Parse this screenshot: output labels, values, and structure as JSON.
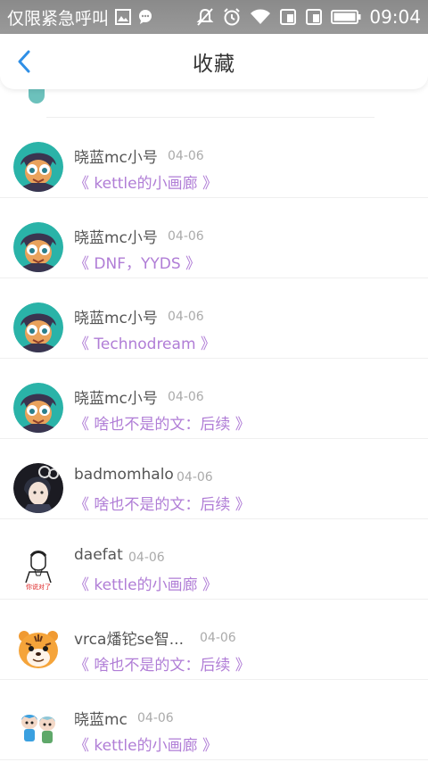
{
  "status_bar": {
    "left_text": "仅限紧急呼叫",
    "time": "09:04",
    "icons": [
      "image-icon",
      "chat-icon",
      "mute-icon",
      "alarm-icon",
      "wifi-icon",
      "sim1-icon",
      "sim2-icon",
      "battery-icon"
    ]
  },
  "header": {
    "back_icon": "chevron-left-icon",
    "title": "收藏"
  },
  "items": [
    {
      "name": "晓蓝mc小号",
      "date": "04-06",
      "link": "《 kettle的小画廊 》",
      "avatar": "hero"
    },
    {
      "name": "晓蓝mc小号",
      "date": "04-06",
      "link": "《 DNF，YYDS 》",
      "avatar": "hero"
    },
    {
      "name": "晓蓝mc小号",
      "date": "04-06",
      "link": "《 Technodream 》",
      "avatar": "hero"
    },
    {
      "name": "晓蓝mc小号",
      "date": "04-06",
      "link": "《 啥也不是的文：后续 》",
      "avatar": "hero"
    },
    {
      "name": "badmomhalo",
      "date": "04-06",
      "link": "《 啥也不是的文：后续 》",
      "avatar": "anime"
    },
    {
      "name": "daefat",
      "date": "04-06",
      "link": "《 kettle的小画廊 》",
      "avatar": "sketch"
    },
    {
      "name": "vrca燔铊se智...",
      "date": "04-06",
      "link": "《 啥也不是的文：后续 》",
      "avatar": "tiger"
    },
    {
      "name": "晓蓝mc",
      "date": "04-06",
      "link": "《 kettle的小画廊 》",
      "avatar": "chibi"
    }
  ],
  "colors": {
    "accent_back": "#2f8fe6",
    "link": "#b07dd6",
    "name": "#555555",
    "date": "#aaaaaa"
  }
}
